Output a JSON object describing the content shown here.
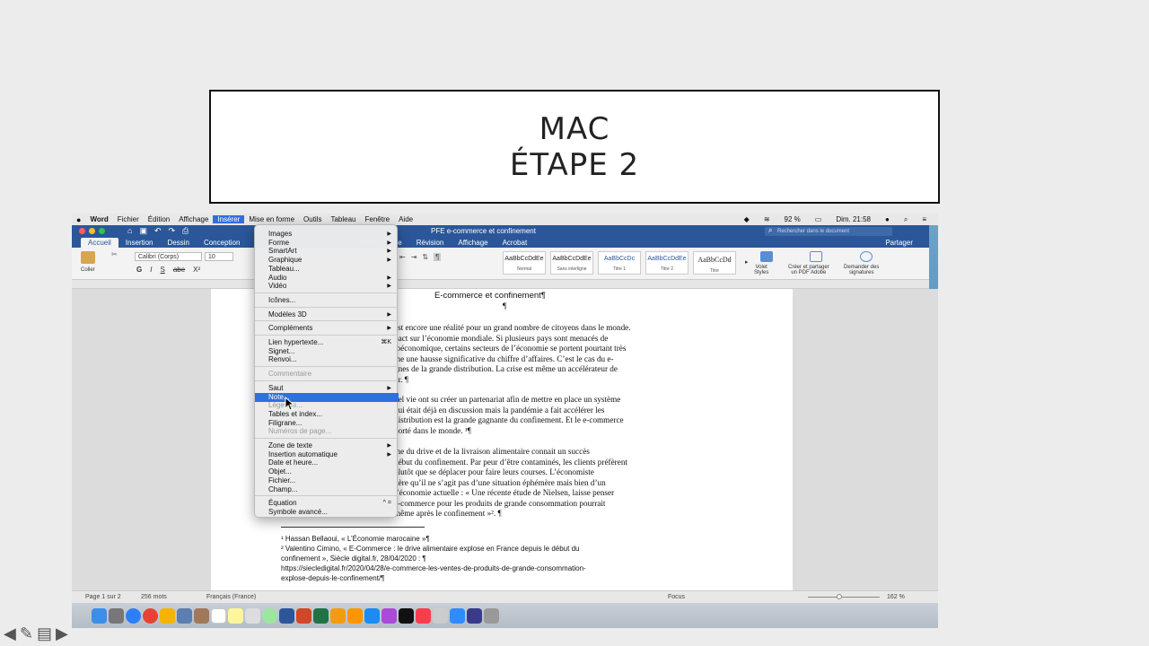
{
  "slide": {
    "title_line1": "MAC",
    "title_line2": "ÉTAPE 2"
  },
  "menubar": {
    "apple": "",
    "app": "Word",
    "items": [
      "Fichier",
      "Édition",
      "Affichage",
      "Insérer",
      "Mise en forme",
      "Outils",
      "Tableau",
      "Fenêtre",
      "Aide"
    ],
    "active": "Insérer",
    "battery": "92 %",
    "clock": "Dim. 21:58"
  },
  "titlebar": {
    "doc_title": "PFE e-commerce et confinement",
    "search_placeholder": "Rechercher dans le document"
  },
  "ribbon": {
    "tabs": [
      "Accueil",
      "Insertion",
      "Dessin",
      "Conception",
      "Publipostage",
      "Révision",
      "Affichage",
      "Acrobat"
    ],
    "active_tab": "Accueil",
    "share": "Partager",
    "paste": "Coller",
    "font_name": "Calibri (Corps)",
    "font_size": "10",
    "styles": [
      {
        "preview": "AaBbCcDdEe",
        "name": "Normal"
      },
      {
        "preview": "AaBbCcDdEe",
        "name": "Sans interligne"
      },
      {
        "preview": "AaBbCcDc",
        "name": "Titre 1"
      },
      {
        "preview": "AaBbCcDdEe",
        "name": "Titre 2"
      },
      {
        "preview": "AaBbCcDd",
        "name": "Titre"
      }
    ],
    "styles_pane": [
      "Volet",
      "Styles"
    ],
    "adobe": [
      "Créer et partager",
      "un PDF Adobe"
    ],
    "signatures": [
      "Demander des",
      "signatures"
    ]
  },
  "menu": {
    "items": [
      {
        "label": "Images",
        "arrow": true
      },
      {
        "label": "Forme",
        "arrow": true
      },
      {
        "label": "SmartArt",
        "arrow": true
      },
      {
        "label": "Graphique",
        "arrow": true
      },
      {
        "label": "Tableau..."
      },
      {
        "label": "Audio",
        "arrow": true
      },
      {
        "label": "Vidéo",
        "arrow": true
      },
      {
        "sep": true
      },
      {
        "label": "Icônes..."
      },
      {
        "sep": true
      },
      {
        "label": "Modèles 3D",
        "arrow": true
      },
      {
        "sep": true
      },
      {
        "label": "Compléments",
        "arrow": true
      },
      {
        "sep": true
      },
      {
        "label": "Lien hypertexte...",
        "shortcut": "⌘K"
      },
      {
        "label": "Signet..."
      },
      {
        "label": "Renvoi..."
      },
      {
        "sep": true
      },
      {
        "label": "Commentaire",
        "disabled": true
      },
      {
        "sep": true
      },
      {
        "label": "Saut",
        "arrow": true
      },
      {
        "label": "Note...",
        "selected": true
      },
      {
        "label": "Légende...",
        "disabled": true
      },
      {
        "label": "Tables et index..."
      },
      {
        "label": "Filigrane..."
      },
      {
        "label": "Numéros de page...",
        "disabled": true
      },
      {
        "sep": true
      },
      {
        "label": "Zone de texte",
        "arrow": true
      },
      {
        "label": "Insertion automatique",
        "arrow": true
      },
      {
        "label": "Date et heure..."
      },
      {
        "label": "Objet..."
      },
      {
        "label": "Fichier..."
      },
      {
        "label": "Champ..."
      },
      {
        "sep": true
      },
      {
        "label": "Équation",
        "shortcut": "^ ="
      },
      {
        "label": "Symbole avancé..."
      }
    ]
  },
  "document": {
    "heading": "E-commerce et confinement¶",
    "pilcrow": "¶",
    "p1": [
      "est encore une réalité pour un grand nombre de citoyens dans le monde.",
      "pact sur l’économie mondiale. Si plusieurs pays sont menacés de",
      "ioéconomique, certains secteurs de l’économie se portent pourtant très",
      "me une hausse significative du chiffre d’affaires. C’est le cas du e-",
      "gnes de la grande distribution. La crise est même un accélérateur de",
      "ur. ¶"
    ],
    "p2": [
      "bel vie ont su créer un partenariat afin de mettre en place un système",
      "qui était déjà en discussion mais la pandémie a fait accélérer les",
      "distribution est la grande gagnante du confinement. Et le e-commerce",
      "porté dans le monde. ¹¶"
    ],
    "p3": [
      "me du drive et de la livraison alimentaire connait un succès",
      "début du confinement. Par peur d’être contaminés, les clients préfèrent",
      "plutôt que se déplacer pour faire leurs courses. L’économiste",
      "dère qu’il ne s’agit pas d’une situation éphémère mais bien d’un",
      "l’économie actuelle : « Une récente étude de Nielsen, laisse penser",
      "e-commerce pour les produits de grande consommation pourrait",
      "même après le confinement »². ¶"
    ],
    "footnotes": [
      "¹ Hassan Bellaoui, « L’Économie marocaine »¶",
      "² Valentino Cimino, « E-Commerce : le drive alimentaire explose en France depuis le début du",
      "confinement », Siècle digital.fr, 28/04/2020 : ¶",
      "https://siecledigital.fr/2020/04/28/e-commerce-les-ventes-de-produits-de-grande-consommation-",
      "explose-depuis-le-confinement/¶"
    ]
  },
  "status": {
    "page": "Page 1 sur 2",
    "words": "256 mots",
    "lang": "Français (France)",
    "focus": "Focus",
    "zoom": "162 %"
  },
  "colors": {
    "word_blue": "#2b579a",
    "menu_highlight": "#2f6fe0"
  }
}
